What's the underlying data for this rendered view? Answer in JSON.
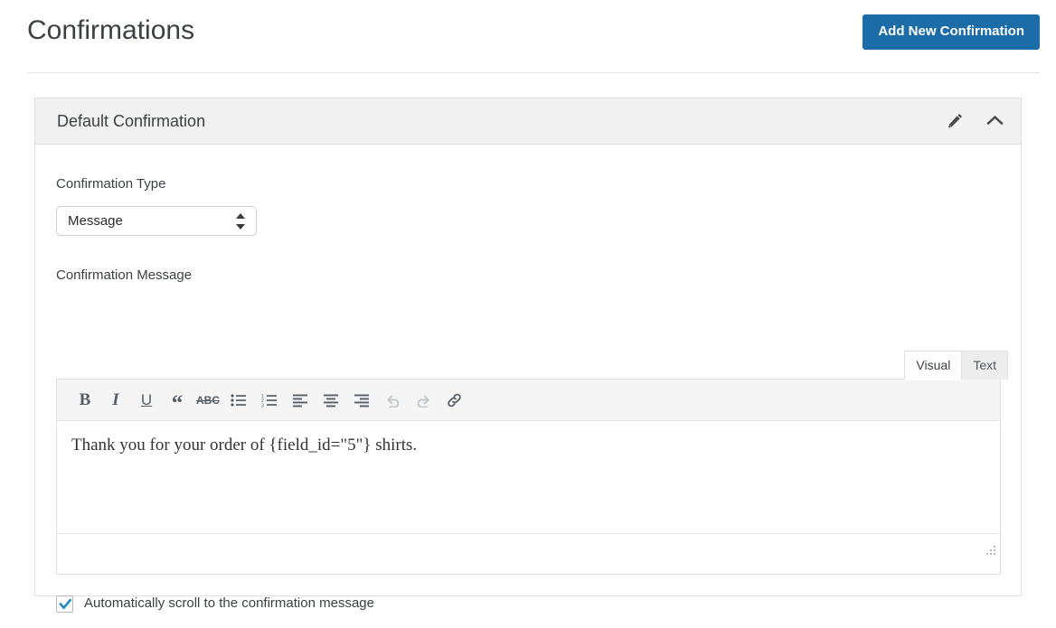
{
  "header": {
    "title": "Confirmations",
    "add_button_label": "Add New Confirmation",
    "accent_color": "#1c6ca8"
  },
  "panel": {
    "header_title": "Default Confirmation",
    "icons": {
      "edit": "pencil-icon",
      "collapse": "chevron-up-icon"
    },
    "fields": {
      "confirmation_type_label": "Confirmation Type",
      "confirmation_type_value": "Message",
      "confirmation_type_options": [
        "Message"
      ],
      "confirmation_message_label": "Confirmation Message"
    },
    "editor": {
      "tabs": [
        {
          "label": "Visual",
          "active": true
        },
        {
          "label": "Text",
          "active": false
        }
      ],
      "toolbar": [
        {
          "name": "bold-icon",
          "glyph": "B",
          "disabled": false
        },
        {
          "name": "italic-icon",
          "glyph": "I",
          "disabled": false
        },
        {
          "name": "underline-icon",
          "glyph": "U",
          "disabled": false
        },
        {
          "name": "blockquote-icon",
          "glyph": "“",
          "disabled": false
        },
        {
          "name": "strikethrough-icon",
          "glyph": "ABC",
          "disabled": false
        },
        {
          "name": "unordered-list-icon",
          "glyph": "",
          "disabled": false
        },
        {
          "name": "ordered-list-icon",
          "glyph": "",
          "disabled": false
        },
        {
          "name": "align-left-icon",
          "glyph": "",
          "disabled": false
        },
        {
          "name": "align-center-icon",
          "glyph": "",
          "disabled": false
        },
        {
          "name": "align-right-icon",
          "glyph": "",
          "disabled": false
        },
        {
          "name": "undo-icon",
          "glyph": "",
          "disabled": true
        },
        {
          "name": "redo-icon",
          "glyph": "",
          "disabled": true
        },
        {
          "name": "link-icon",
          "glyph": "",
          "disabled": false
        }
      ],
      "content_text": "Thank you for your order of {field_id=\"5\"} shirts.",
      "resize_handle": "resize-grip-icon"
    },
    "checkbox": {
      "label": "Automatically scroll to the confirmation message",
      "checked": true,
      "check_color": "#1e8cbe"
    }
  }
}
